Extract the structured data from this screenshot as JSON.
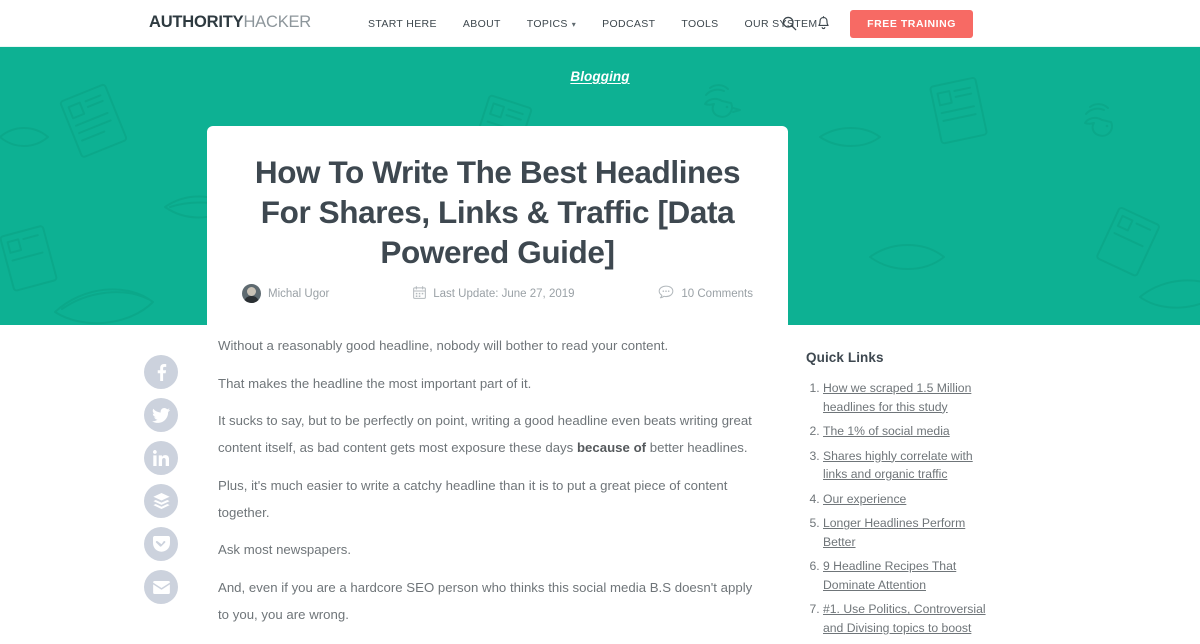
{
  "header": {
    "logo_bold": "AUTHORITY",
    "logo_light": "HACKER",
    "nav": [
      {
        "label": "START HERE",
        "has_caret": false
      },
      {
        "label": "ABOUT",
        "has_caret": false
      },
      {
        "label": "TOPICS",
        "has_caret": true
      },
      {
        "label": "PODCAST",
        "has_caret": false
      },
      {
        "label": "TOOLS",
        "has_caret": false
      },
      {
        "label": "OUR SYSTEM",
        "has_caret": false
      }
    ],
    "search_icon": "search-icon",
    "bell_icon": "bell-icon",
    "cta_label": "FREE TRAINING",
    "cta_color": "#f76a64"
  },
  "hero": {
    "background_color": "#0db193",
    "category": "Blogging",
    "title": "How To Write The Best Headlines For Shares, Links & Traffic [Data Powered Guide]",
    "meta": {
      "author": "Michal Ugor",
      "date": "Last Update: June 27, 2019",
      "comments": "10 Comments"
    }
  },
  "share": {
    "buttons": [
      {
        "name": "facebook",
        "icon": "facebook-icon"
      },
      {
        "name": "twitter",
        "icon": "twitter-icon"
      },
      {
        "name": "linkedin",
        "icon": "linkedin-icon"
      },
      {
        "name": "buffer",
        "icon": "buffer-icon"
      },
      {
        "name": "pocket",
        "icon": "pocket-icon"
      },
      {
        "name": "email",
        "icon": "email-icon"
      }
    ]
  },
  "article": {
    "paragraphs": [
      {
        "text": "Without a reasonably good headline, nobody will bother to read your content."
      },
      {
        "text": "That makes the headline the most important part of it."
      },
      {
        "pre": "It sucks to say, but to be perfectly on point, writing a good headline even beats writing great content itself, as bad content gets most exposure these days ",
        "bold": "because of",
        "post": " better headlines."
      },
      {
        "text": "Plus, it's much easier to write a catchy headline than it is to put a great piece of content together."
      },
      {
        "text": "Ask most newspapers."
      },
      {
        "text": "And, even if you are a hardcore SEO person who thinks this social media B.S doesn't apply to you, you are wrong."
      }
    ]
  },
  "quick_links": {
    "title": "Quick Links",
    "items": [
      "How we scraped 1.5 Million headlines for this study",
      "The 1% of social media",
      "Shares highly correlate with links and organic traffic",
      "Our experience",
      "Longer Headlines Perform Better",
      "9 Headline Recipes That Dominate Attention",
      "#1. Use Politics, Controversial and Divising topics to boost"
    ]
  }
}
